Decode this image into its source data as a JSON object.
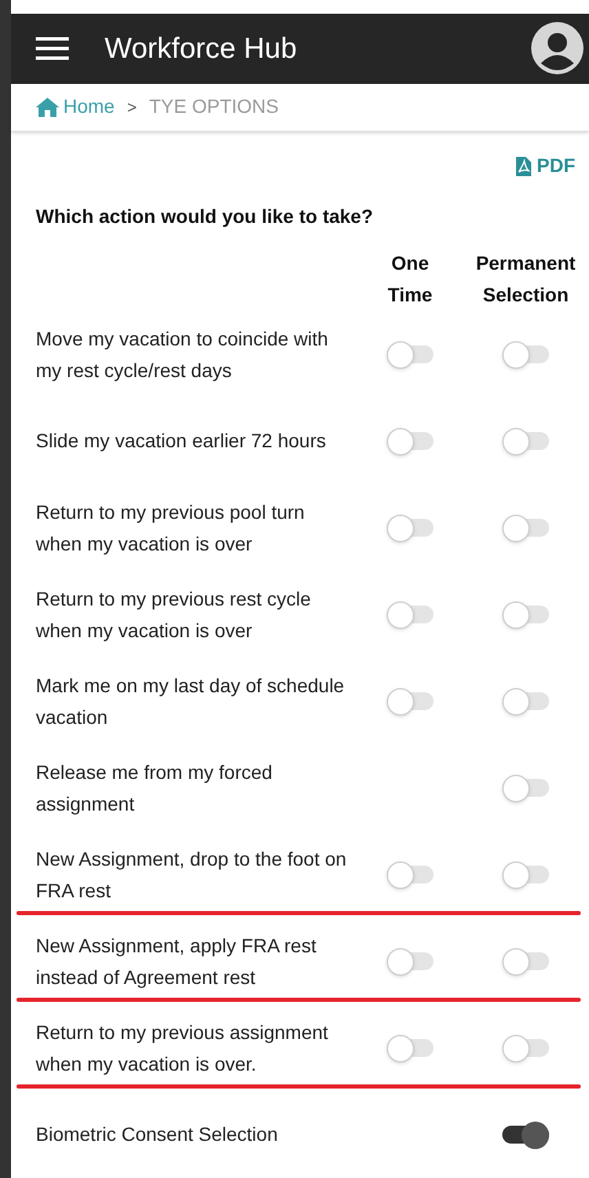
{
  "header": {
    "title": "Workforce Hub"
  },
  "breadcrumb": {
    "home": "Home",
    "separator": ">",
    "current": "TYE OPTIONS"
  },
  "pdf_link": "PDF",
  "question": "Which action would you like to take?",
  "columns": [
    "One Time",
    "Permanent Selection"
  ],
  "options": [
    {
      "label": "Move my vacation to coincide with my rest cycle/rest days",
      "one_time": {
        "on": false
      },
      "permanent": {
        "on": false
      },
      "underlined": false
    },
    {
      "label": "Slide my vacation earlier 72 hours",
      "one_time": {
        "on": false
      },
      "permanent": {
        "on": false
      },
      "underlined": false
    },
    {
      "label": "Return to my previous pool turn when my vacation is over",
      "one_time": {
        "on": false
      },
      "permanent": {
        "on": false
      },
      "underlined": false
    },
    {
      "label": "Return to my previous rest cycle when my vacation is over",
      "one_time": {
        "on": false
      },
      "permanent": {
        "on": false
      },
      "underlined": false
    },
    {
      "label": "Mark me on my last day of schedule vacation",
      "one_time": {
        "on": false
      },
      "permanent": {
        "on": false
      },
      "underlined": false
    },
    {
      "label": "Release me from my forced assignment",
      "permanent": {
        "on": false
      },
      "underlined": false
    },
    {
      "label": "New Assignment, drop to the foot on FRA rest",
      "one_time": {
        "on": false
      },
      "permanent": {
        "on": false
      },
      "underlined": true
    },
    {
      "label": "New Assignment, apply FRA rest instead of Agreement rest",
      "one_time": {
        "on": false
      },
      "permanent": {
        "on": false
      },
      "underlined": true
    },
    {
      "label": "Return to my previous assignment when my vacation is over.",
      "one_time": {
        "on": false
      },
      "permanent": {
        "on": false
      },
      "underlined": true
    },
    {
      "label": "Biometric Consent Selection",
      "permanent": {
        "on": true
      },
      "underlined": false
    }
  ]
}
